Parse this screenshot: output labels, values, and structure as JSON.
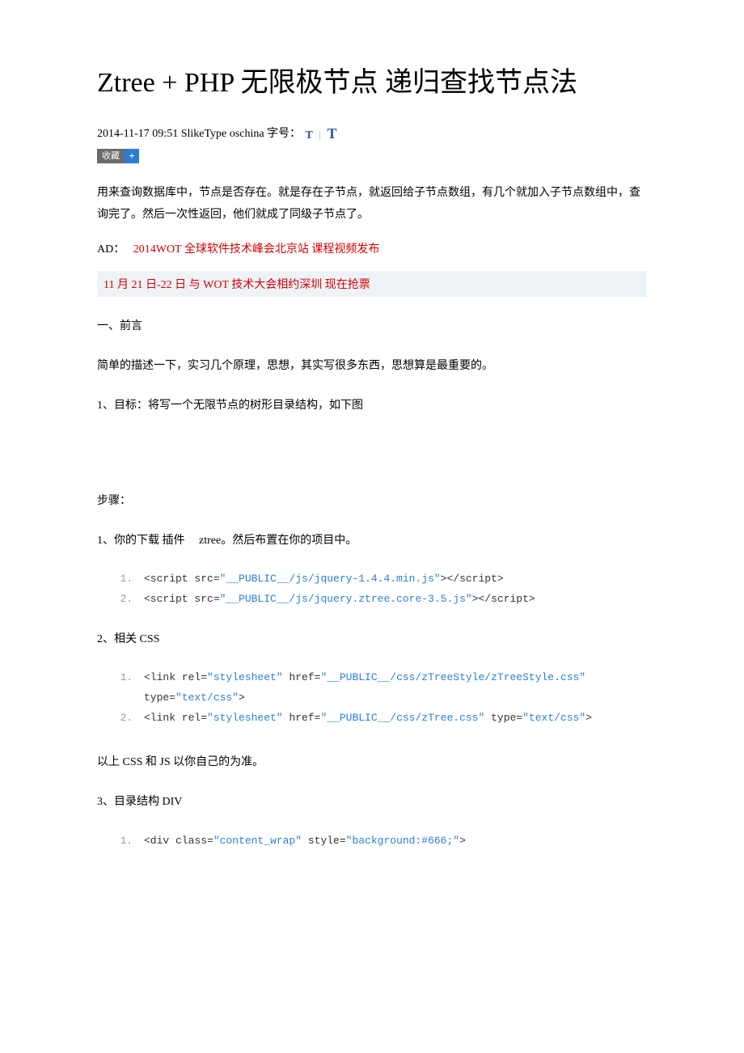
{
  "title": "Ztree + PHP 无限极节点 递归查找节点法",
  "meta": {
    "datetime": "2014-11-17 09:51",
    "author": "SlikeType",
    "source": "oschina",
    "font_label": "字号：",
    "t_small": "T",
    "t_large": "T",
    "collect_label": "收藏",
    "collect_plus": "+"
  },
  "summary": "用来查询数据库中，节点是否存在。就是存在子节点，就返回给子节点数组，有几个就加入子节点数组中，查询完了。然后一次性返回，他们就成了同级子节点了。",
  "ad": {
    "prefix": "AD：",
    "link_text": "2014WOT 全球软件技术峰会北京站 课程视频发布"
  },
  "promo": "11 月 21 日-22 日 与 WOT 技术大会相约深圳 现在抢票",
  "sections": {
    "s1": "一、前言",
    "s1_p1": "简单的描述一下，实习几个原理，思想，其实写很多东西，思想算是最重要的。",
    "s1_p2": "1、目标：将写一个无限节点的树形目录结构，如下图",
    "steps_label": "步骤：",
    "step1_intro": "1、你的下载 插件　 ztree。然后布置在你的项目中。",
    "step2_intro": "2、相关 CSS",
    "after_css": "以上 CSS 和 JS 以你自己的为准。",
    "step3_intro": "3、目录结构 DIV"
  },
  "code": {
    "block1": {
      "l1": {
        "pre": "<script src=",
        "str": "\"__PUBLIC__/js/jquery-1.4.4.min.js\"",
        "post": "></script>"
      },
      "l2": {
        "pre": "<script src=",
        "str": "\"__PUBLIC__/js/jquery.ztree.core-3.5.js\"",
        "post": "></script>"
      }
    },
    "block2": {
      "l1": {
        "p1": "<link rel=",
        "s1": "\"stylesheet\"",
        "p2": " href=",
        "s2": "\"__PUBLIC__/css/zTreeStyle/zTreeStyle.css\"",
        "p3": " type=",
        "s3": "\"text/css\"",
        "p4": ">"
      },
      "l2": {
        "p1": "<link rel=",
        "s1": "\"stylesheet\"",
        "p2": " href=",
        "s2": "\"__PUBLIC__/css/zTree.css\"",
        "p3": " type=",
        "s3": "\"text/css\"",
        "p4": ">"
      }
    },
    "block3": {
      "l1": {
        "p1": "<div class=",
        "s1": "\"content_wrap\"",
        "p2": "  style=",
        "s2": "\"background:#666;\"",
        "p3": ">"
      }
    }
  }
}
